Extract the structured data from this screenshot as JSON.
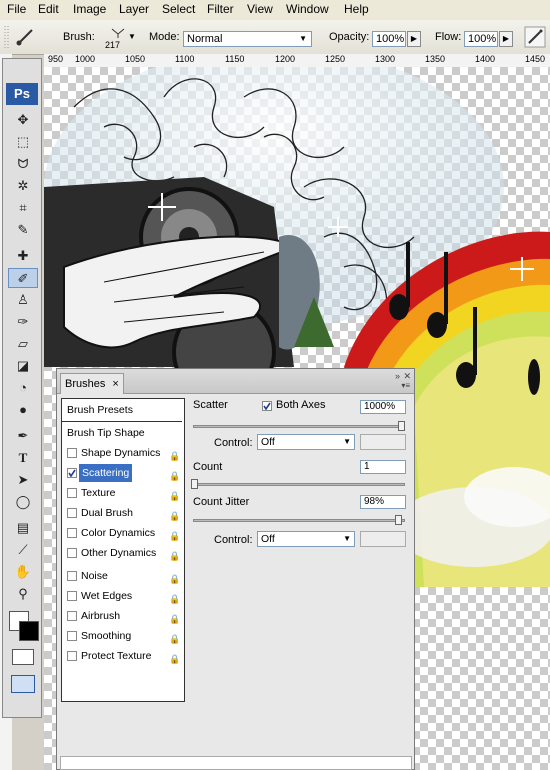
{
  "menu": [
    "File",
    "Edit",
    "Image",
    "Layer",
    "Select",
    "Filter",
    "View",
    "Window",
    "Help"
  ],
  "options": {
    "brush_label": "Brush:",
    "brush_size": "217",
    "mode_label": "Mode:",
    "mode_value": "Normal",
    "opacity_label": "Opacity:",
    "opacity_value": "100%",
    "flow_label": "Flow:",
    "flow_value": "100%"
  },
  "ruler": {
    "ticks": [
      "950",
      "1000",
      "1050",
      "1100",
      "1150",
      "1200",
      "1250",
      "1300",
      "1350",
      "1400",
      "1450"
    ]
  },
  "toolbox": {
    "logo": "Ps"
  },
  "brushes": {
    "tab": "Brushes",
    "close": "×",
    "brush_presets": "Brush Presets",
    "brush_tip_shape": "Brush Tip Shape",
    "options": [
      {
        "label": "Shape Dynamics",
        "checked": false
      },
      {
        "label": "Scattering",
        "checked": true
      },
      {
        "label": "Texture",
        "checked": false
      },
      {
        "label": "Dual Brush",
        "checked": false
      },
      {
        "label": "Color Dynamics",
        "checked": false
      },
      {
        "label": "Other Dynamics",
        "checked": false
      }
    ],
    "extras": [
      {
        "label": "Noise",
        "checked": false
      },
      {
        "label": "Wet Edges",
        "checked": false
      },
      {
        "label": "Airbrush",
        "checked": false
      },
      {
        "label": "Smoothing",
        "checked": false
      },
      {
        "label": "Protect Texture",
        "checked": false
      }
    ],
    "scatter_label": "Scatter",
    "both_axes_label": "Both Axes",
    "scatter_value": "1000%",
    "control_label": "Control:",
    "control_value": "Off",
    "count_label": "Count",
    "count_value": "1",
    "count_jitter_label": "Count Jitter",
    "count_jitter_value": "98%",
    "control2_label": "Control:",
    "control2_value": "Off"
  }
}
